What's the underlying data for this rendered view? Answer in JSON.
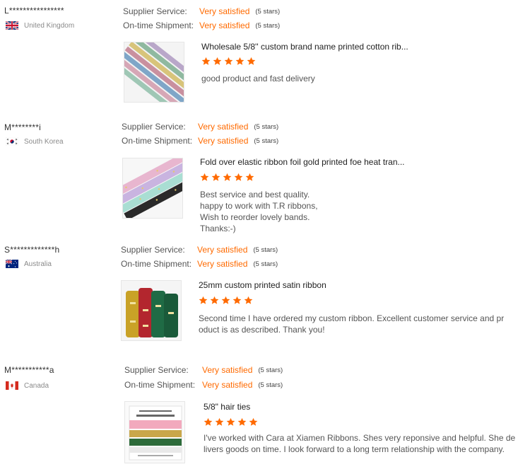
{
  "colors": {
    "accent": "#ff6a00",
    "star": "#ff6a00"
  },
  "labels": {
    "supplier_service": "Supplier Service:",
    "ontime_shipment": "On-time Shipment:"
  },
  "reviews": [
    {
      "user": "L****************",
      "country": "United Kingdom",
      "flag_icon": "uk-flag-icon",
      "supplier_service": {
        "value": "Very satisfied",
        "stars": "(5 stars)"
      },
      "ontime_shipment": {
        "value": "Very satisfied",
        "stars": "(5 stars)"
      },
      "product_title": "Wholesale 5/8'' custom brand name printed cotton rib...",
      "rating": 5,
      "comment": "good product and fast delivery"
    },
    {
      "user": "M********i",
      "country": "South Korea",
      "flag_icon": "south-korea-flag-icon",
      "supplier_service": {
        "value": "Very satisfied",
        "stars": "(5 stars)"
      },
      "ontime_shipment": {
        "value": "Very satisfied",
        "stars": "(5 stars)"
      },
      "product_title": "Fold over elastic ribbon foil gold printed foe heat tran...",
      "rating": 5,
      "comment": "Best service and best quality.\nhappy to work with T.R ribbons,\nWish to reorder lovely bands.\nThanks:-)"
    },
    {
      "user": "S*************h",
      "country": "Australia",
      "flag_icon": "australia-flag-icon",
      "supplier_service": {
        "value": "Very satisfied",
        "stars": "(5 stars)"
      },
      "ontime_shipment": {
        "value": "Very satisfied",
        "stars": "(5 stars)"
      },
      "product_title": "25mm custom printed satin ribbon",
      "rating": 5,
      "comment": "Second time I have ordered my custom ribbon. Excellent customer service and pr\noduct is as described. Thank you!"
    },
    {
      "user": "M***********a",
      "country": "Canada",
      "flag_icon": "canada-flag-icon",
      "supplier_service": {
        "value": "Very satisfied",
        "stars": "(5 stars)"
      },
      "ontime_shipment": {
        "value": "Very satisfied",
        "stars": "(5 stars)"
      },
      "product_title": "5/8\" hair ties",
      "rating": 5,
      "comment": "I've worked with Cara at Xiamen Ribbons. Shes very reponsive and helpful. She de\nlivers goods on time. I look forward to a long term relationship with the company."
    }
  ]
}
